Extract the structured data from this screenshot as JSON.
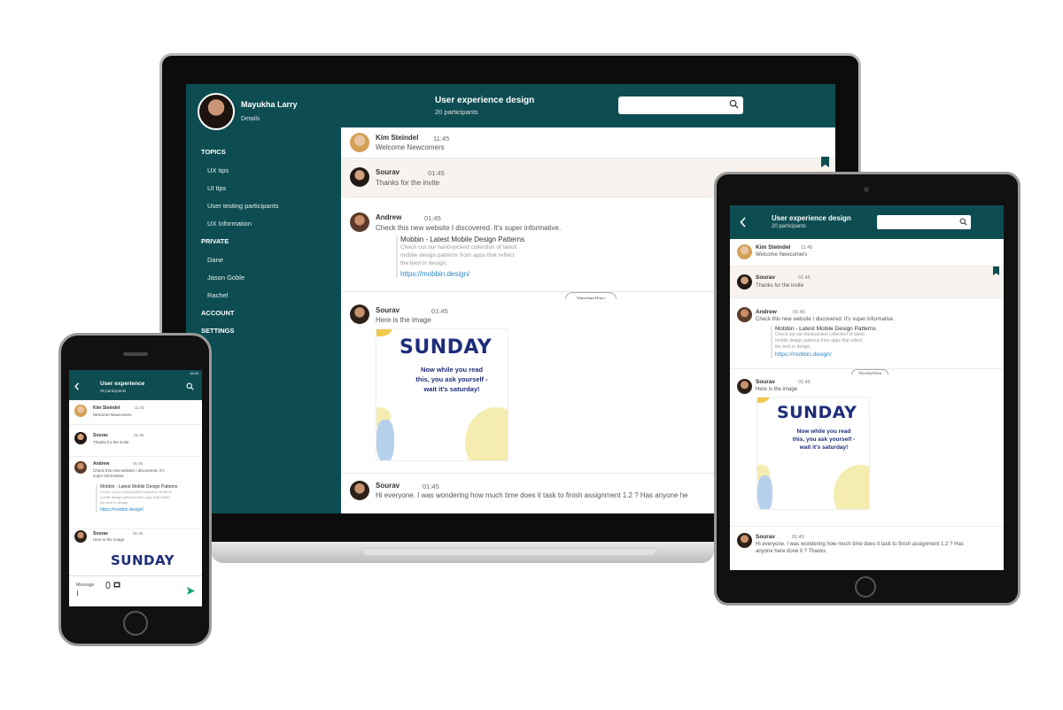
{
  "colors": {
    "brand": "#0d4d52",
    "link": "#2b86c5",
    "pinned_bg": "#f8f3ef",
    "send": "#1aa37a"
  },
  "laptop": {
    "user": {
      "name": "Mayukha Larry",
      "details": "Details"
    },
    "nav": {
      "topics": "TOPICS",
      "topic_items": [
        "UX tips",
        "UI tips",
        "User testing participants",
        "UX Information"
      ],
      "private": "PRIVATE",
      "private_items": [
        "Dane",
        "Jason Goble",
        "Rachel"
      ],
      "account": "ACCOUNT",
      "settings": "SETTINGS"
    },
    "channel": {
      "title": "User experience design",
      "participants": "20 participants"
    },
    "search": {
      "placeholder": ""
    },
    "messages": [
      {
        "name": "Kim Steindel",
        "time": "11:45",
        "text": "Welcome Newcomers"
      },
      {
        "name": "Sourav",
        "time": "01:45",
        "text": "Thanks for the invite"
      },
      {
        "name": "Andrew",
        "time": "01:45",
        "text": "Check this new website I discovered. It's super informative."
      },
      {
        "name": "Sourav",
        "time": "01:45",
        "text": "Here is the image"
      },
      {
        "name": "Sourav",
        "time": "01:45",
        "text": "Hi everyone. I was wondering how much time does it task to finish assignment 1.2 ? Has anyone he"
      }
    ],
    "link_card": {
      "title": "Mobbin - Latest Mobile Design Patterns",
      "desc_lines": [
        "Check out our hand-picked collection of latest",
        "mobile design patterns from apps that reflect",
        "the best in design."
      ],
      "url": "https://mobbin.design/"
    },
    "divider": "Yesterday",
    "image": {
      "headline": "SUNDAY",
      "lines": [
        "Now while you read",
        "this, you ask yourself -",
        "wait it's saturday!"
      ]
    }
  },
  "tablet": {
    "channel": {
      "title": "User experience design",
      "participants": "20 participants"
    },
    "messages": [
      {
        "name": "Kim Steindel",
        "time": "11:45",
        "text": "Welcome Newcomers"
      },
      {
        "name": "Sourav",
        "time": "01:45",
        "text": "Thanks for the invite"
      },
      {
        "name": "Andrew",
        "time": "01:45",
        "text": "Check this new website I discovered. It's super informative."
      },
      {
        "name": "Sourav",
        "time": "01:45",
        "text": "Here is the image"
      },
      {
        "name": "Sourav",
        "time": "01:45",
        "text_lines": [
          "Hi everyone. I was wondering how much time does it task to finish assignment 1.2 ? Has",
          "anyone here done it ? Thanks"
        ]
      }
    ],
    "link_card": {
      "title": "Mobbin - Latest Mobile Design Patterns",
      "desc_lines": [
        "Check out our hand-picked collection of latest",
        "mobile design patterns from apps that reflect",
        "the best in design."
      ],
      "url": "https://mobbin.design/"
    },
    "divider": "Yesterday",
    "image": {
      "headline": "SUNDAY",
      "lines": [
        "Now while you read",
        "this, you ask yourself -",
        "wait it's saturday!"
      ]
    }
  },
  "phone": {
    "status_time": "16:25",
    "channel": {
      "title": "User experience",
      "participants": "20 participants"
    },
    "messages": [
      {
        "name": "Kim Steindel",
        "time": "11:45",
        "text": "Welcome Newcomers"
      },
      {
        "name": "Sourav",
        "time": "01:45",
        "text": "Thanks for the invite"
      },
      {
        "name": "Andrew",
        "time": "01:45",
        "text_lines": [
          "Check this new website I discovered. It's",
          "super informative."
        ]
      },
      {
        "name": "Sourav",
        "time": "01:45",
        "text": "Here is the image"
      }
    ],
    "link_card": {
      "title": "Mobbin - Latest Mobile Design Patterns",
      "desc_lines": [
        "Check out our hand-picked collection of latest",
        "mobile design patterns from apps that reflect",
        "the best in design."
      ],
      "url": "https://mobbin.design/"
    },
    "image": {
      "headline": "SUNDAY"
    },
    "composer": {
      "placeholder": "Message"
    }
  }
}
